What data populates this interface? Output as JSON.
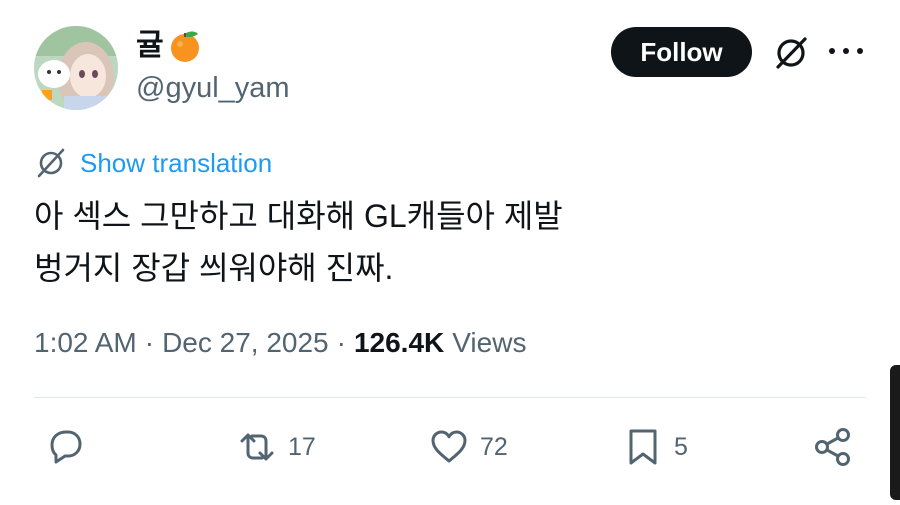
{
  "author": {
    "display_name": "귤",
    "display_name_emoji": "orange-emoji",
    "handle": "@gyul_yam",
    "avatar": "anime-avatar"
  },
  "header": {
    "follow_label": "Follow",
    "grok_icon": "grok-icon",
    "more_icon": "more-dots-icon"
  },
  "translation": {
    "icon": "grok-icon",
    "label": "Show translation"
  },
  "tweet": {
    "text": "아 섹스 그만하고 대화해 GL캐들아 제발\n벙거지 장갑 씌워야해 진짜."
  },
  "meta": {
    "time": "1:02 AM",
    "separator": "·",
    "date": "Dec 27, 2025",
    "views_count": "126.4K",
    "views_label": "Views"
  },
  "actions": {
    "reply": {
      "icon": "reply-icon",
      "count": ""
    },
    "retweet": {
      "icon": "retweet-icon",
      "count": "17"
    },
    "like": {
      "icon": "heart-icon",
      "count": "72"
    },
    "bookmark": {
      "icon": "bookmark-icon",
      "count": "5"
    },
    "share": {
      "icon": "share-icon"
    }
  },
  "colors": {
    "accent": "#1d9bf0",
    "text": "#0f1419",
    "secondary": "#536471",
    "button_bg": "#0f1419"
  }
}
